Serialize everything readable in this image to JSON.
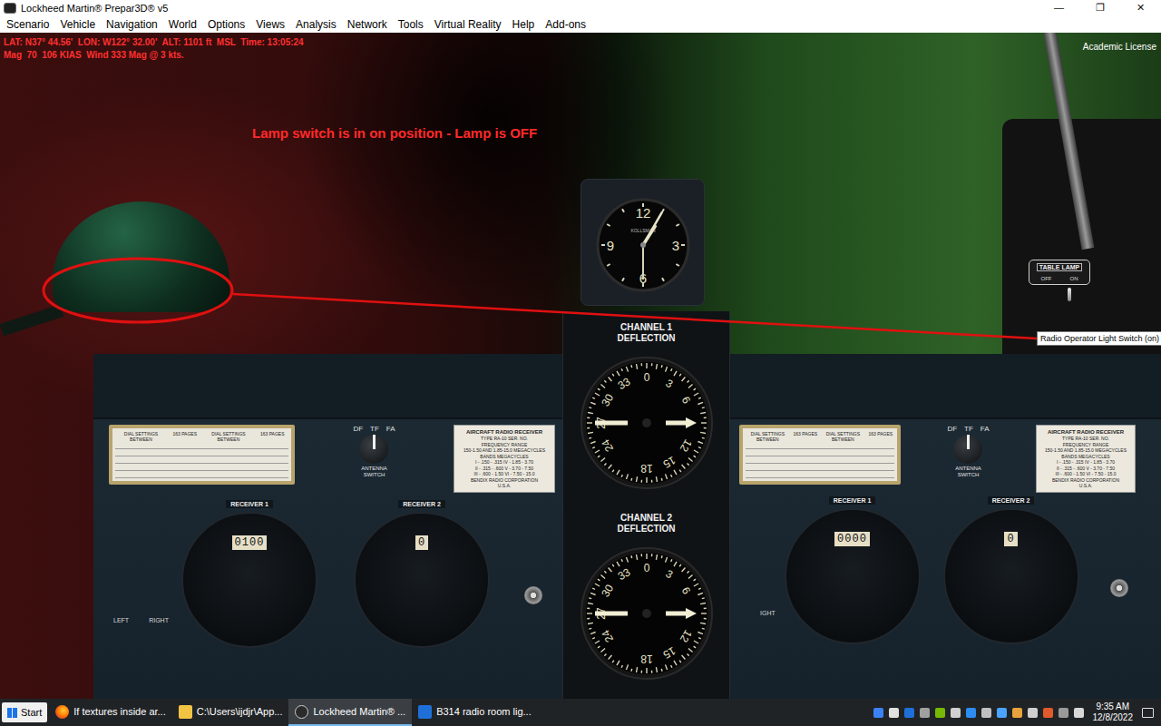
{
  "window": {
    "title": "Lockheed Martin® Prepar3D® v5",
    "controls": [
      "—",
      "❐",
      "✕"
    ]
  },
  "menu": [
    "Scenario",
    "Vehicle",
    "Navigation",
    "World",
    "Options",
    "Views",
    "Analysis",
    "Network",
    "Tools",
    "Virtual Reality",
    "Help",
    "Add-ons"
  ],
  "hud": {
    "lines": [
      "LAT: N37° 44.56'  LON: W122° 32.00'  ALT: 1101 ft  MSL  Time: 13:05:24",
      "Mag  70  106 KIAS  Wind 333 Mag @ 3 kts."
    ],
    "license": "Academic License"
  },
  "annotation": {
    "text": "Lamp switch is in on position - Lamp is OFF",
    "tooltip": "Radio Operator Light Switch (on)"
  },
  "lamp": {
    "on": false
  },
  "lamp_switch": {
    "label": "TABLE LAMP",
    "positions": [
      {
        "label": "OFF",
        "selected": false
      },
      {
        "label": "ON",
        "selected": true
      }
    ]
  },
  "clock": {
    "numerals": [
      "12",
      "3",
      "6",
      "9"
    ],
    "brand": "KOLLSMAN",
    "hours": 1,
    "minutes": 5,
    "seconds": 30
  },
  "deflection": [
    {
      "title": "CHANNEL 1",
      "subtitle": "DEFLECTION",
      "ticks": [
        "0",
        "3",
        "6",
        "12",
        "15",
        "18",
        "24",
        "27",
        "30",
        "33"
      ],
      "needle": 90
    },
    {
      "title": "CHANNEL 2",
      "subtitle": "DEFLECTION",
      "ticks": [
        "0",
        "3",
        "6",
        "12",
        "15",
        "18",
        "24",
        "27",
        "30",
        "33"
      ],
      "needle": 90
    }
  ],
  "receivers": [
    {
      "plate": {
        "headers": [
          "DIAL SETTINGS BETWEEN",
          "163 PAGES",
          "DIAL SETTINGS BETWEEN",
          "163 PAGES"
        ]
      },
      "antenna": {
        "label": "ANTENNA SWITCH",
        "positions": [
          {
            "label": "DF",
            "selected": false
          },
          {
            "label": "TF",
            "selected": true
          },
          {
            "label": "FA",
            "selected": false
          }
        ]
      },
      "nameplate": {
        "lines": [
          "AIRCRAFT RADIO RECEIVER",
          "TYPE RA-10   SER. NO.",
          "FREQUENCY RANGE",
          "150-1.50 AND 1.85-15.0 MEGACYCLES",
          "BANDS  MEGACYCLES",
          "I - .150 - .315   IV - 1.85 - 3.70",
          "II - .315 - .600   V - 3.70 - 7.50",
          "III - .600 - 1.50   VI - 7.50 - 15.0",
          "BENDIX RADIO CORPORATION",
          "U.S.A."
        ]
      },
      "channels": [
        {
          "label": "RECEIVER 1",
          "counter": "0100"
        },
        {
          "label": "RECEIVER 2",
          "counter": "0"
        }
      ],
      "side_labels": [
        "LEFT",
        "RIGHT"
      ]
    },
    {
      "plate": {
        "headers": [
          "DIAL SETTINGS BETWEEN",
          "163 PAGES",
          "DIAL SETTINGS BETWEEN",
          "163 PAGES"
        ]
      },
      "antenna": {
        "label": "ANTENNA SWITCH",
        "positions": [
          {
            "label": "DF",
            "selected": false
          },
          {
            "label": "TF",
            "selected": true
          },
          {
            "label": "FA",
            "selected": false
          }
        ]
      },
      "nameplate": {
        "lines": [
          "AIRCRAFT RADIO RECEIVER",
          "TYPE RA-10   SER. NO.",
          "FREQUENCY RANGE",
          "150-1.50 AND 1.85-15.0 MEGACYCLES",
          "BANDS  MEGACYCLES",
          "I - .150 - .315   IV - 1.85 - 3.70",
          "II - .315 - .600   V - 3.70 - 7.50",
          "III - .600 - 1.50   VI - 7.50 - 15.0",
          "BENDIX RADIO CORPORATION",
          "U.S.A."
        ]
      },
      "channels": [
        {
          "label": "RECEIVER 1",
          "counter": "0000"
        },
        {
          "label": "RECEIVER 2",
          "counter": "0"
        }
      ],
      "side_labels": [
        "IGHT"
      ]
    }
  ],
  "taskbar": {
    "start": "Start",
    "items": [
      {
        "label": "If textures inside ar...",
        "kind": "browser",
        "selected": false
      },
      {
        "label": "C:\\Users\\ijdjr\\App...",
        "kind": "folder",
        "selected": false
      },
      {
        "label": "Lockheed Martin® ...",
        "kind": "sim",
        "selected": true
      },
      {
        "label": "B314 radio room lig...",
        "kind": "mail",
        "selected": false
      }
    ],
    "time": "9:35 AM",
    "date": "12/8/2022"
  }
}
